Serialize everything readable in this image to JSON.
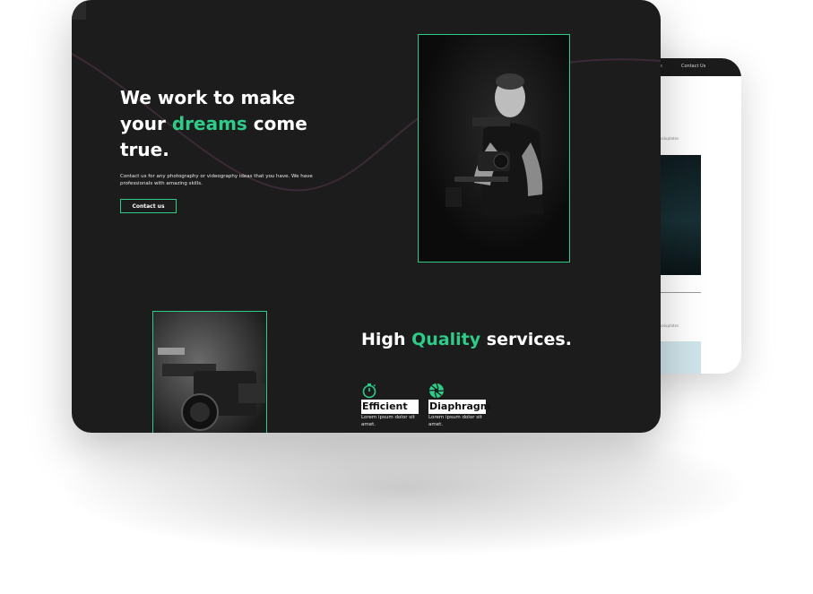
{
  "hero": {
    "title_part1": "We work to make your ",
    "title_accent": "dreams",
    "title_part2": " come true.",
    "description": "Contact us for any photography or videography ideas that you have. We have professionals with amazing skills.",
    "cta_label": "Contact us"
  },
  "services": {
    "title_part1": "High ",
    "title_accent": "Quality",
    "title_part2": " services.",
    "features": [
      {
        "label": "Efficient",
        "description": "Lorem ipsum dolor sit amet.",
        "icon": "stopwatch-icon"
      },
      {
        "label": "Diaphragm",
        "description": "Lorem ipsum dolor sit amet.",
        "icon": "aperture-icon"
      }
    ]
  },
  "back_device": {
    "nav_items": [
      "rk",
      "Contact Us"
    ],
    "snippet_1": "voluptates",
    "snippet_2": "voluptates"
  },
  "colors": {
    "accent": "#2ecc88",
    "background": "#1c1c1c",
    "text": "#ffffff"
  }
}
